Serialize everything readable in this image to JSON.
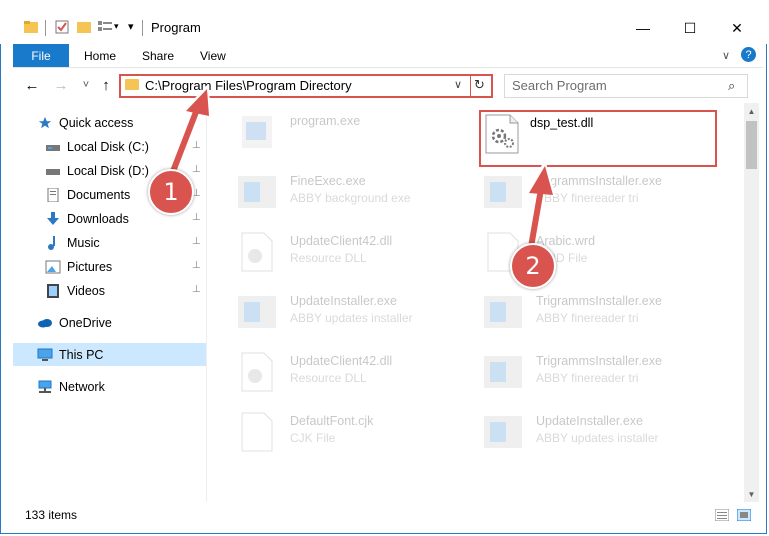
{
  "window": {
    "title": "Program",
    "controls": {
      "minimize": "—",
      "maximize": "☐",
      "close": "✕"
    }
  },
  "ribbon": {
    "tabs": [
      "File",
      "Home",
      "Share",
      "View"
    ],
    "help": "?",
    "expand": "∨"
  },
  "nav": {
    "back": "←",
    "forward": "→",
    "recent": "˅",
    "up": "↑",
    "address": "C:\\Program Files\\Program Directory",
    "chevron": "∨",
    "refresh": "↻",
    "search_placeholder": "Search Program",
    "search_icon": "⌕"
  },
  "sidebar": {
    "items": [
      {
        "label": "Quick access",
        "icon": "star-icon"
      },
      {
        "label": "Local Disk (C:)",
        "icon": "drive-icon"
      },
      {
        "label": "Local Disk (D:)",
        "icon": "drive-icon"
      },
      {
        "label": "Documents",
        "icon": "documents-icon"
      },
      {
        "label": "Downloads",
        "icon": "download-icon"
      },
      {
        "label": "Music",
        "icon": "music-icon"
      },
      {
        "label": "Pictures",
        "icon": "pictures-icon"
      },
      {
        "label": "Videos",
        "icon": "videos-icon"
      },
      {
        "label": "OneDrive",
        "icon": "cloud-icon"
      },
      {
        "label": "This PC",
        "icon": "computer-icon"
      },
      {
        "label": "Network",
        "icon": "network-icon"
      }
    ],
    "pin": "📌"
  },
  "files": [
    {
      "name": "program.exe",
      "desc": ""
    },
    {
      "name": "dsp_test.dll",
      "desc": ""
    },
    {
      "name": "FineExec.exe",
      "desc": "ABBY background exe"
    },
    {
      "name": "TrigrammsInstaller.exe",
      "desc": "ABBY finereader tri"
    },
    {
      "name": "UpdateClient42.dll",
      "desc": "Resource DLL"
    },
    {
      "name": "Arabic.wrd",
      "desc": "WRD File"
    },
    {
      "name": "UpdateInstaller.exe",
      "desc": "ABBY updates installer"
    },
    {
      "name": "TrigrammsInstaller.exe",
      "desc": "ABBY finereader tri"
    },
    {
      "name": "UpdateClient42.dll",
      "desc": "Resource DLL"
    },
    {
      "name": "TrigrammsInstaller.exe",
      "desc": "ABBY finereader tri"
    },
    {
      "name": "DefaultFont.cjk",
      "desc": "CJK File"
    },
    {
      "name": "UpdateInstaller.exe",
      "desc": "ABBY updates installer"
    }
  ],
  "status": {
    "count": "133 items"
  },
  "annotations": {
    "step1": "1",
    "step2": "2"
  },
  "colors": {
    "accent": "#1979ca",
    "annotation": "#d9534f",
    "selection": "#cce8ff"
  }
}
